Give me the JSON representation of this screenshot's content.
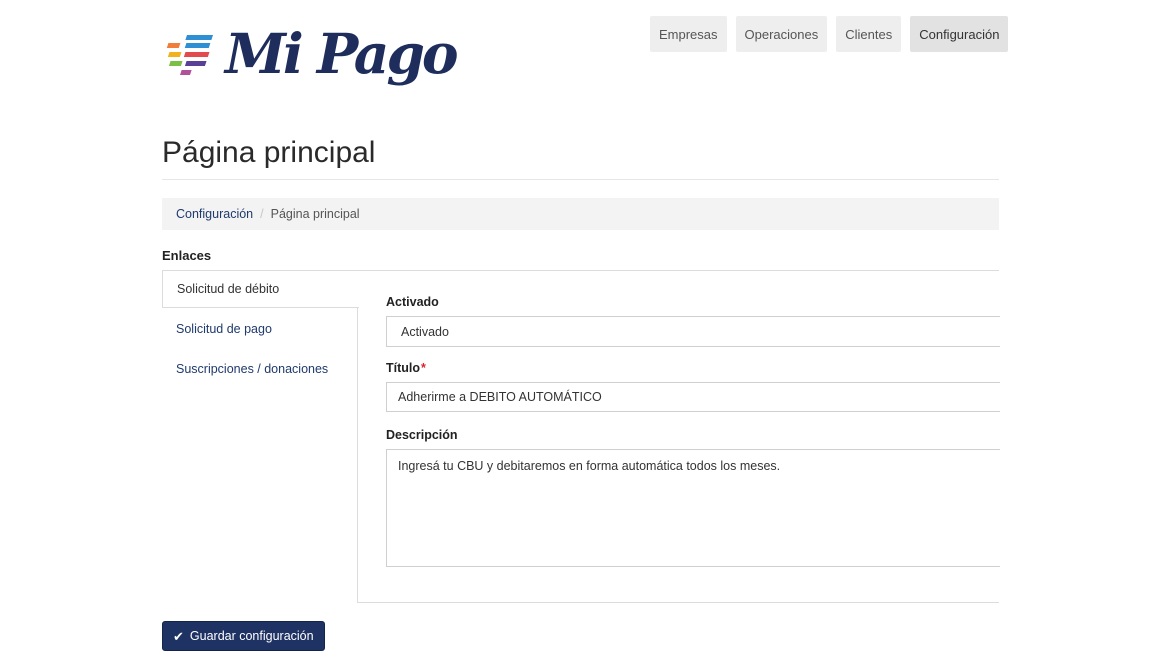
{
  "brand": {
    "name": "Mi Pago"
  },
  "topnav": {
    "items": [
      {
        "label": "Empresas"
      },
      {
        "label": "Operaciones"
      },
      {
        "label": "Clientes"
      },
      {
        "label": "Configuración",
        "active": true
      }
    ]
  },
  "page": {
    "title": "Página principal"
  },
  "breadcrumb": {
    "parent": "Configuración",
    "separator": "/",
    "current": "Página principal"
  },
  "links_section": {
    "label": "Enlaces",
    "tabs": [
      {
        "label": "Solicitud de débito",
        "active": true
      },
      {
        "label": "Solicitud de pago"
      },
      {
        "label": "Suscripciones / donaciones"
      }
    ]
  },
  "form": {
    "activado_label": "Activado",
    "activado_value": "Activado",
    "titulo_label": "Título",
    "required_mark": "*",
    "titulo_value": "Adherirme a DEBITO AUTOMÁTICO",
    "descripcion_label": "Descripción",
    "descripcion_value": "Ingresá tu CBU y debitaremos en forma automática todos los meses."
  },
  "actions": {
    "save_label": "Guardar configuración",
    "save_icon": "check-icon"
  },
  "colors": {
    "brand_navy": "#1f2d5c",
    "link": "#1f3a6d",
    "button_bg": "#1f3264",
    "required": "#d9232d"
  }
}
